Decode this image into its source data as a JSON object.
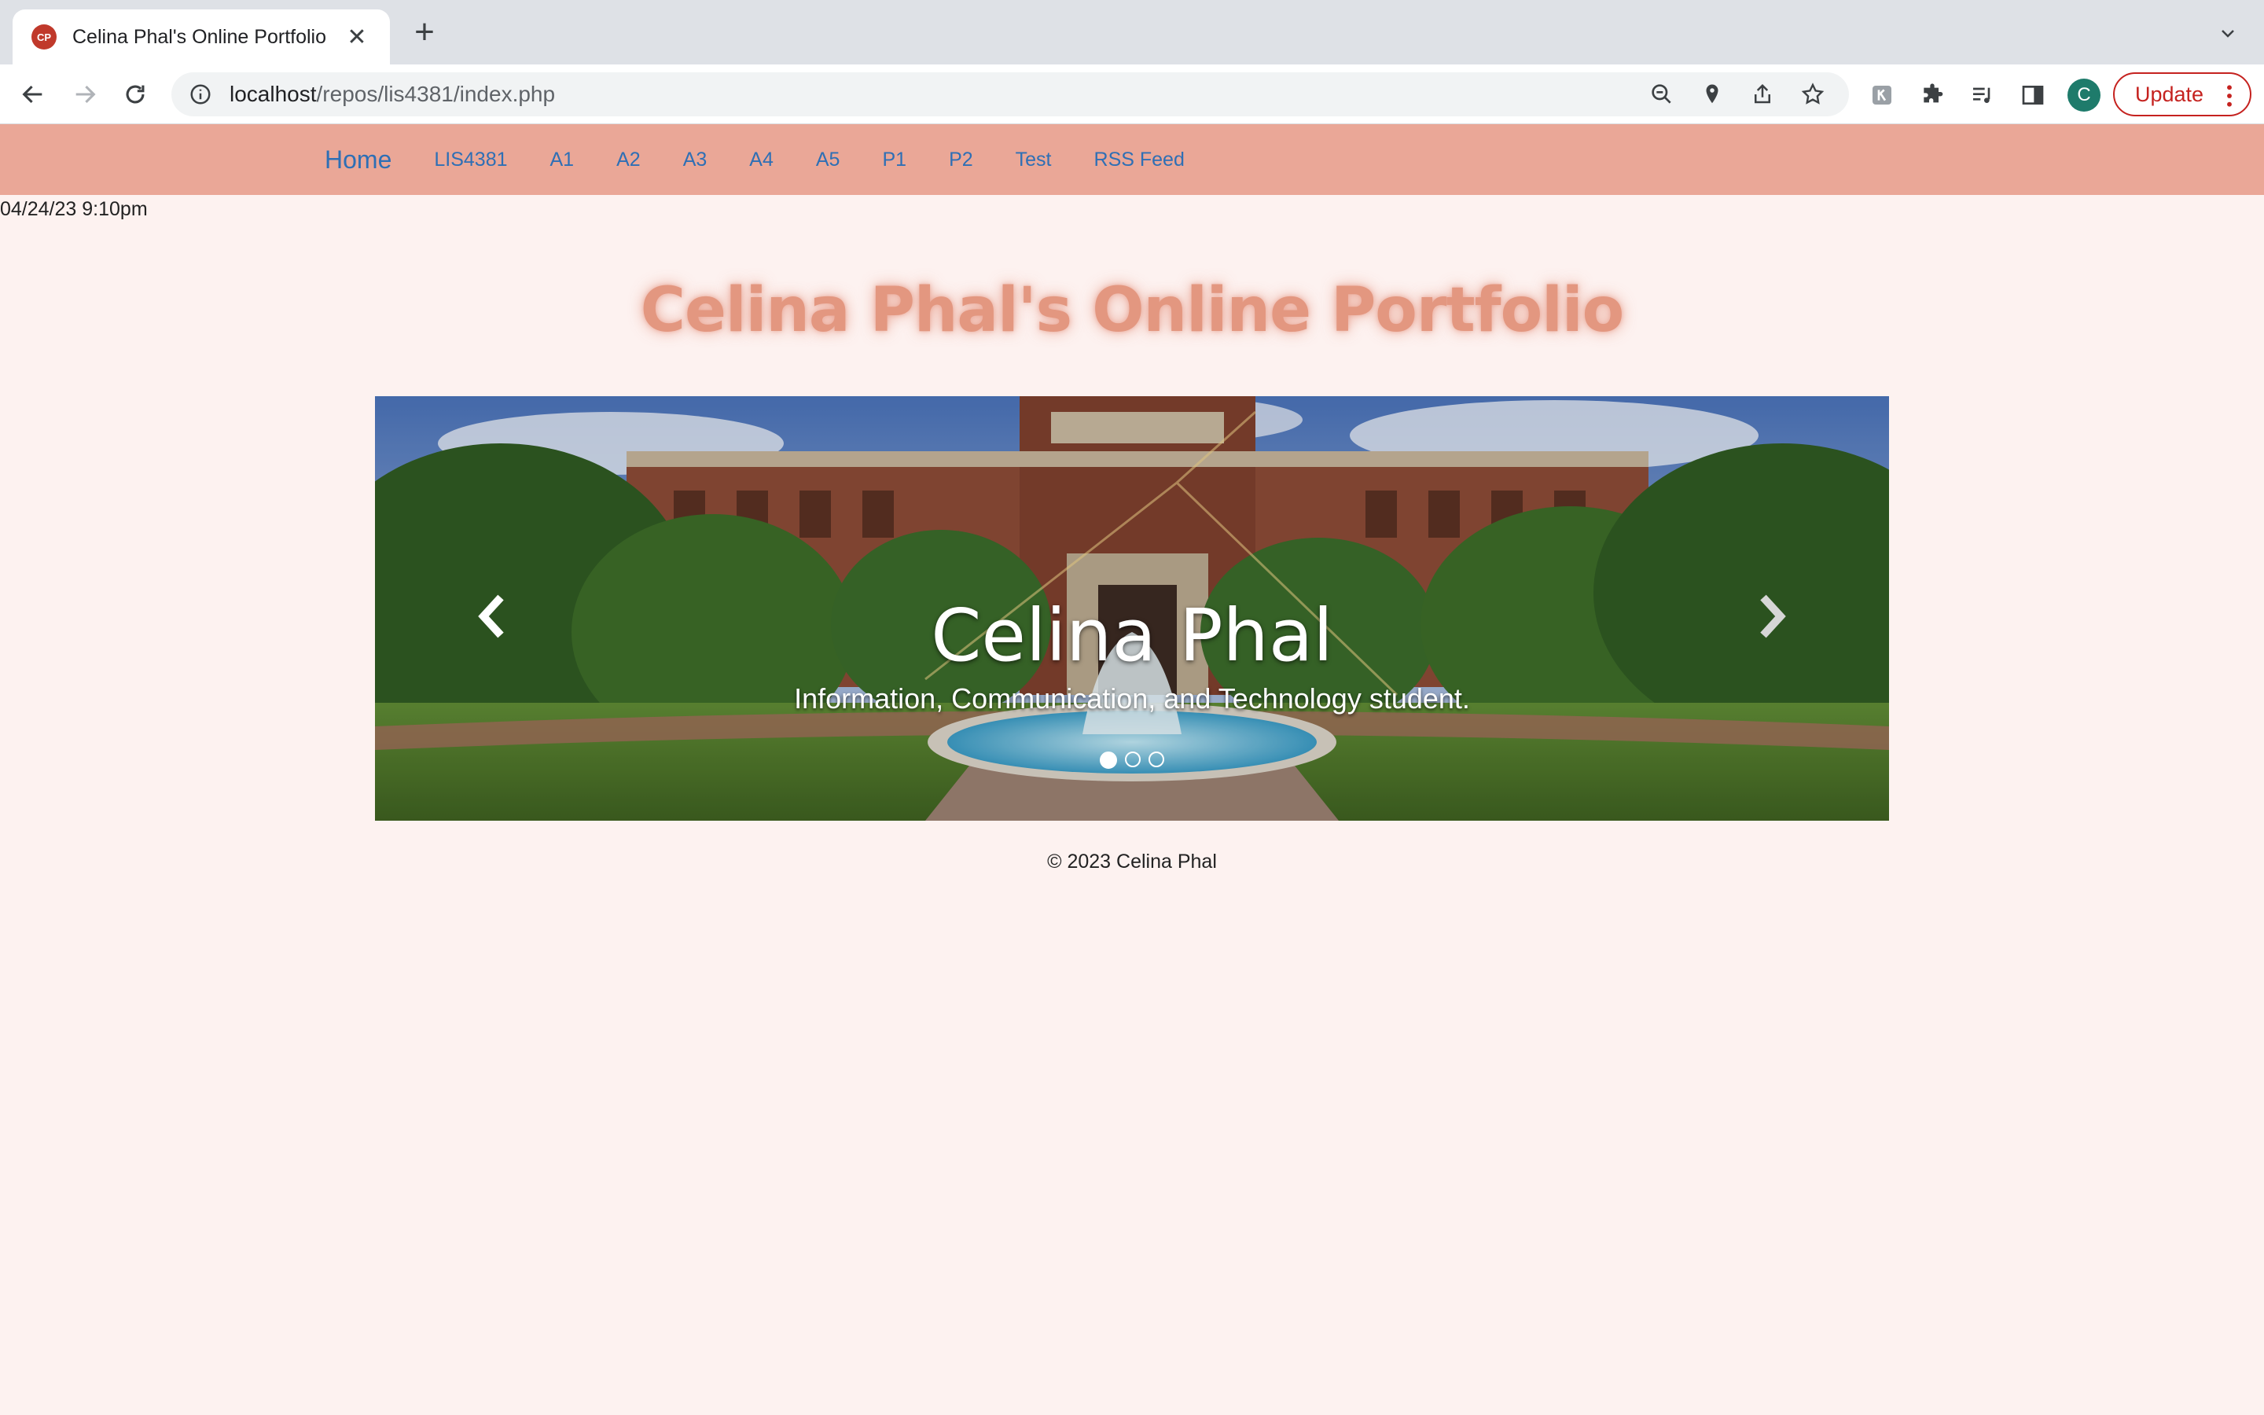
{
  "browser": {
    "tab_title": "Celina Phal's Online Portfolio",
    "favicon_text": "CP",
    "url_host": "localhost",
    "url_path": "/repos/lis4381/index.php",
    "profile_initial": "C",
    "update_label": "Update"
  },
  "navbar": {
    "brand": "Home",
    "links": [
      "LIS4381",
      "A1",
      "A2",
      "A3",
      "A4",
      "A5",
      "P1",
      "P2",
      "Test",
      "RSS Feed"
    ]
  },
  "timestamp": "04/24/23 9:10pm",
  "page_title": "Celina Phal's Online Portfolio",
  "carousel": {
    "caption_title": "Celina Phal",
    "caption_subtitle": "Information, Communication, and Technology student.",
    "slide_count": 3,
    "active_slide": 1
  },
  "footer": "© 2023 Celina Phal",
  "colors": {
    "navbar_bg": "#eaa797",
    "page_bg": "#fdf2f0",
    "link": "#2e6fb5",
    "title": "#e39780"
  }
}
